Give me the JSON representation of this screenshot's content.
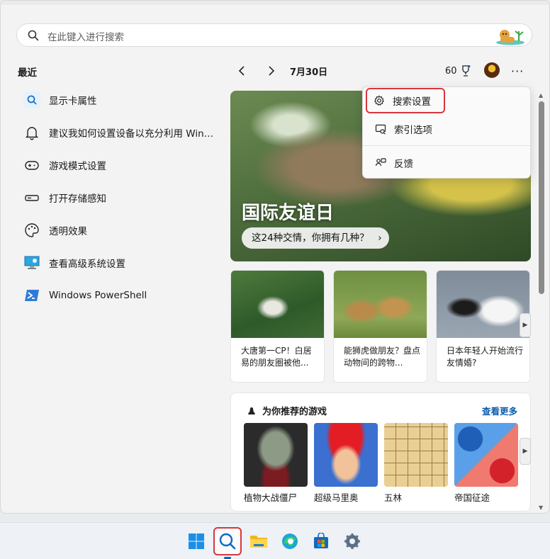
{
  "search": {
    "placeholder": "在此键入进行搜索"
  },
  "recent": {
    "title": "最近",
    "items": [
      {
        "label": "显示卡属性",
        "icon": "search-app-icon"
      },
      {
        "label": "建议我如何设置设备以充分利用 Windows",
        "icon": "bell-icon"
      },
      {
        "label": "游戏模式设置",
        "icon": "gamepad-icon"
      },
      {
        "label": "打开存储感知",
        "icon": "storage-icon"
      },
      {
        "label": "透明效果",
        "icon": "palette-icon"
      },
      {
        "label": "查看高级系统设置",
        "icon": "monitor-settings-icon"
      },
      {
        "label": "Windows PowerShell",
        "icon": "powershell-icon"
      }
    ]
  },
  "header": {
    "date": "7月30日",
    "points": "60"
  },
  "hero": {
    "title": "国际友谊日",
    "subtitle": "这24种交情，你拥有几种？"
  },
  "cards": [
    {
      "text": "大唐第一CP！白居易的朋友圈被他..."
    },
    {
      "text": "能狮虎做朋友？盘点动物间的跨物..."
    },
    {
      "text": "日本年轻人开始流行友情婚?"
    }
  ],
  "games": {
    "title": "为你推荐的游戏",
    "more": "查看更多",
    "items": [
      {
        "name": "植物大战僵尸"
      },
      {
        "name": "超级马里奥"
      },
      {
        "name": "五林"
      },
      {
        "name": "帝国征途"
      }
    ]
  },
  "menu": {
    "items": [
      {
        "label": "搜索设置",
        "icon": "gear-icon",
        "highlighted": true
      },
      {
        "label": "索引选项",
        "icon": "index-icon"
      },
      {
        "label": "反馈",
        "icon": "feedback-icon"
      }
    ]
  },
  "taskbar": {
    "icons": [
      "windows-start-icon",
      "search-icon",
      "file-explorer-icon",
      "edge-icon",
      "store-icon",
      "settings-icon"
    ],
    "active": "search-icon"
  },
  "colors": {
    "highlight": "#d9363e",
    "link": "#0b5cad",
    "accent": "#0067c0"
  }
}
